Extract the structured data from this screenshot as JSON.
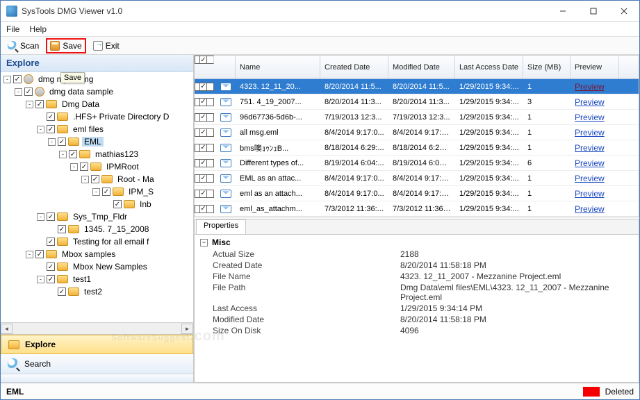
{
  "window": {
    "title": "SysTools DMG Viewer v1.0"
  },
  "menu": {
    "file": "File",
    "help": "Help"
  },
  "toolbar": {
    "scan": "Scan",
    "save": "Save",
    "exit": "Exit"
  },
  "tooltip": {
    "save": "Save"
  },
  "panels": {
    "explore": "Explore",
    "search": "Search",
    "properties_tab": "Properties"
  },
  "tree": [
    {
      "depth": 0,
      "toggle": "-",
      "label": "dmg           mple.dmg",
      "icon": "cd"
    },
    {
      "depth": 1,
      "toggle": "-",
      "label": "dmg data sample",
      "icon": "cd"
    },
    {
      "depth": 2,
      "toggle": "-",
      "label": "Dmg Data"
    },
    {
      "depth": 3,
      "toggle": "",
      "label": ".HFS+ Private Directory D"
    },
    {
      "depth": 3,
      "toggle": "-",
      "label": "eml files"
    },
    {
      "depth": 4,
      "toggle": "-",
      "label": "EML",
      "sel": true
    },
    {
      "depth": 5,
      "toggle": "-",
      "label": "mathias123"
    },
    {
      "depth": 6,
      "toggle": "-",
      "label": "IPMRoot"
    },
    {
      "depth": 7,
      "toggle": "-",
      "label": "Root - Ma"
    },
    {
      "depth": 8,
      "toggle": "-",
      "label": "IPM_S"
    },
    {
      "depth": 9,
      "toggle": "",
      "label": "Inb"
    },
    {
      "depth": 3,
      "toggle": "-",
      "label": "Sys_Tmp_Fldr"
    },
    {
      "depth": 4,
      "toggle": "",
      "label": "1345. 7_15_2008 "
    },
    {
      "depth": 3,
      "toggle": "",
      "label": "Testing for all email f"
    },
    {
      "depth": 2,
      "toggle": "-",
      "label": "Mbox samples"
    },
    {
      "depth": 3,
      "toggle": "",
      "label": "Mbox New Samples"
    },
    {
      "depth": 3,
      "toggle": "-",
      "label": "test1"
    },
    {
      "depth": 4,
      "toggle": "",
      "label": "test2"
    }
  ],
  "grid": {
    "headers": {
      "name": "Name",
      "created": "Created Date",
      "modified": "Modified Date",
      "last": "Last Access Date",
      "size": "Size (MB)",
      "preview": "Preview"
    },
    "rows": [
      {
        "sel": true,
        "name": "4323. 12_11_20...",
        "cd": "8/20/2014 11:5...",
        "md": "8/20/2014 11:5...",
        "la": "1/29/2015 9:34:...",
        "sz": "1",
        "pv": "Preview"
      },
      {
        "name": "751. 4_19_2007...",
        "cd": "8/20/2014 11:3...",
        "md": "8/20/2014 11:3...",
        "la": "1/29/2015 9:34:...",
        "sz": "3",
        "pv": "Preview"
      },
      {
        "name": "96d67736-5d6b-...",
        "cd": "7/19/2013 12:3...",
        "md": "7/19/2013 12:3...",
        "la": "1/29/2015 9:34:...",
        "sz": "1",
        "pv": "Preview"
      },
      {
        "name": "all msg.eml",
        "cd": "8/4/2014 9:17:0...",
        "md": "8/4/2014 9:17:0...",
        "la": "1/29/2015 9:34:...",
        "sz": "1",
        "pv": "Preview"
      },
      {
        "name": "bms噢ｮｩﾝｭB...",
        "cd": "8/18/2014 6:29:...",
        "md": "8/18/2014 6:29:...",
        "la": "1/29/2015 9:34:...",
        "sz": "1",
        "pv": "Preview"
      },
      {
        "name": "Different types of...",
        "cd": "8/19/2014 6:04:...",
        "md": "8/19/2014 6:04:...",
        "la": "1/29/2015 9:34:...",
        "sz": "6",
        "pv": "Preview"
      },
      {
        "name": "EML as an attac...",
        "cd": "8/4/2014 9:17:0...",
        "md": "8/4/2014 9:17:0...",
        "la": "1/29/2015 9:34:...",
        "sz": "1",
        "pv": "Preview"
      },
      {
        "name": "eml as an attach...",
        "cd": "8/4/2014 9:17:0...",
        "md": "8/4/2014 9:17:0...",
        "la": "1/29/2015 9:34:...",
        "sz": "1",
        "pv": "Preview"
      },
      {
        "name": "eml_as_attachm...",
        "cd": "7/3/2012 11:36:...",
        "md": "7/3/2012 11:36:...",
        "la": "1/29/2015 9:34:...",
        "sz": "1",
        "pv": "Preview"
      }
    ]
  },
  "props": {
    "group": "Misc",
    "items": [
      {
        "k": "Actual Size",
        "v": "2188"
      },
      {
        "k": "Created Date",
        "v": "8/20/2014 11:58:18 PM"
      },
      {
        "k": "File Name",
        "v": "4323. 12_11_2007 - Mezzanine Project.eml"
      },
      {
        "k": "File Path",
        "v": "Dmg Data\\eml files\\EML\\4323. 12_11_2007 - Mezzanine Project.eml"
      },
      {
        "k": "Last Access",
        "v": "1/29/2015 9:34:14 PM"
      },
      {
        "k": "Modified Date",
        "v": "8/20/2014 11:58:18 PM"
      },
      {
        "k": "Size On Disk",
        "v": "4096"
      }
    ]
  },
  "status": {
    "left": "EML",
    "deleted": "Deleted"
  },
  "watermark": {
    "main": "SoftwareSuggest",
    "suf": ".com"
  }
}
